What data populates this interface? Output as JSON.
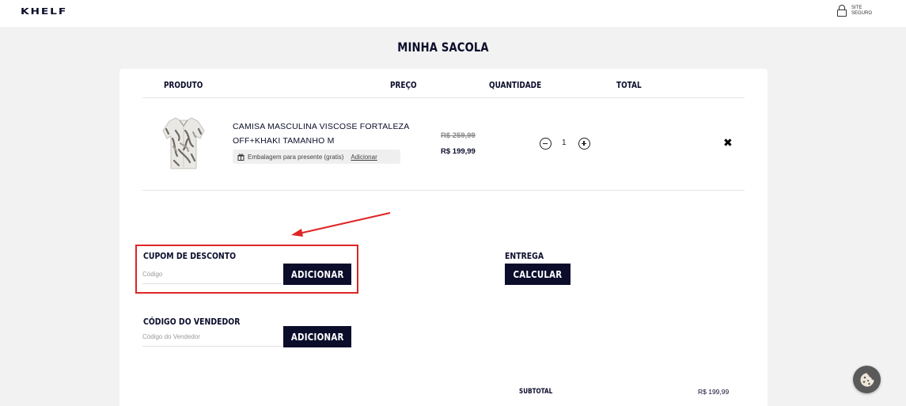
{
  "header": {
    "logo": "KHELF",
    "secure_line1": "SITE",
    "secure_line2": "SEGURO"
  },
  "page_title": "MINHA SACOLA",
  "table": {
    "headers": [
      "PRODUTO",
      "PREÇO",
      "QUANTIDADE",
      "TOTAL"
    ]
  },
  "item": {
    "name_line1": "CAMISA MASCULINA VISCOSE FORTALEZA",
    "name_line2": "OFF+KHAKI TAMANHO M",
    "gift_text": "Embalagem para presente (gratis)",
    "gift_link": "Adicionar",
    "old_price": "R$ 259,99",
    "price": "R$ 199,99",
    "quantity": "1"
  },
  "coupon": {
    "label": "CUPOM DE DESCONTO",
    "placeholder": "Código",
    "button": "ADICIONAR"
  },
  "shipping": {
    "label": "ENTREGA",
    "button": "CALCULAR"
  },
  "seller": {
    "label": "CÓDIGO DO VENDEDOR",
    "placeholder": "Código do Vendedor",
    "button": "ADICIONAR"
  },
  "summary": {
    "subtotal_label": "SUBTOTAL",
    "subtotal_value": "R$ 199,99"
  },
  "colors": {
    "navy": "#0b0d2b",
    "annotation_red": "#e02424",
    "background": "#f2f2f2"
  },
  "icons": [
    "lock-icon",
    "gift-icon",
    "minus-icon",
    "plus-icon",
    "close-icon",
    "cookie-icon"
  ]
}
